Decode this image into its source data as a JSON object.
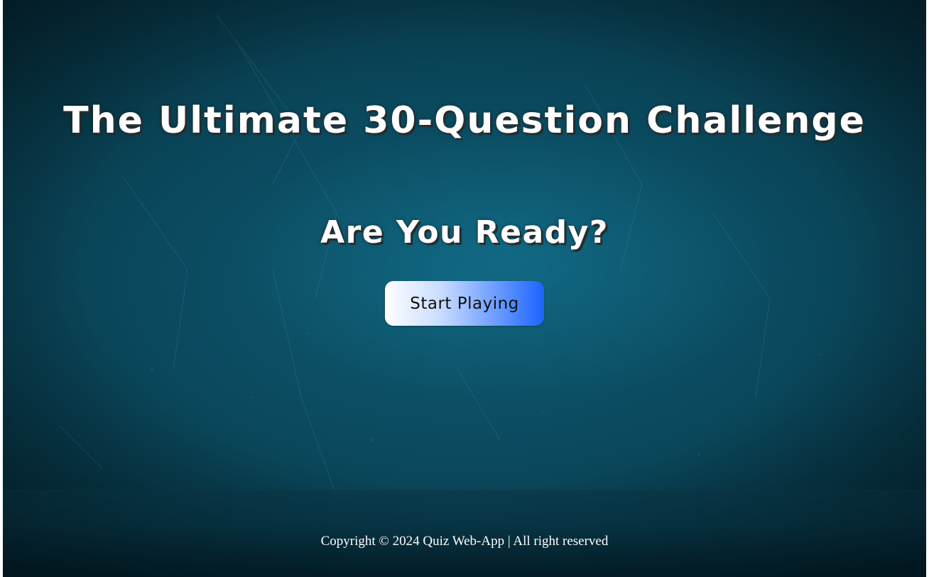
{
  "hero": {
    "title": "The Ultimate 30-Question Challenge",
    "subtitle": "Are You Ready?",
    "start_button_label": "Start Playing"
  },
  "footer": {
    "copyright": "Copyright © 2024 Quiz Web-App | All right reserved"
  },
  "colors": {
    "background_teal": "#0a4457",
    "button_gradient_start": "#ffffff",
    "button_gradient_end": "#1c63ff",
    "text": "#ffffff"
  }
}
